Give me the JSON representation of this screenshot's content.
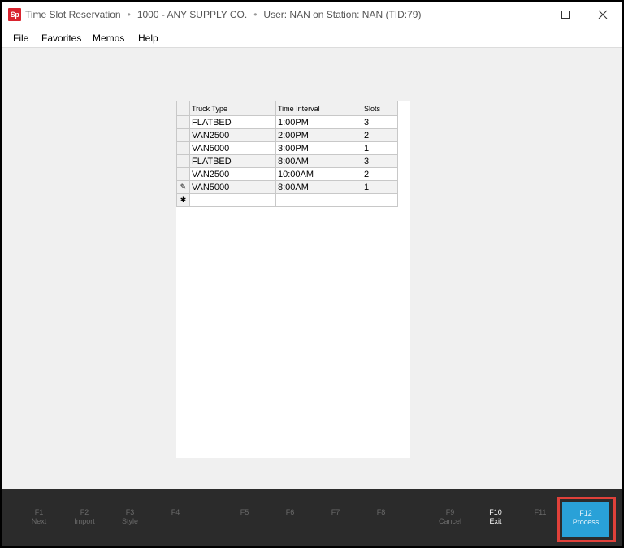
{
  "titlebar": {
    "app_icon": "Sp",
    "title": "Time Slot Reservation",
    "company": "1000 - ANY SUPPLY CO.",
    "user": "User: NAN on Station: NAN (TID:79)",
    "separator": "•"
  },
  "menu": {
    "items": [
      "File",
      "Favorites",
      "Memos",
      "Help"
    ]
  },
  "grid": {
    "columns": [
      "Truck Type",
      "Time Interval",
      "Slots"
    ],
    "rows": [
      {
        "indicator": "",
        "truck": "FLATBED",
        "time": "1:00PM",
        "slots": "3"
      },
      {
        "indicator": "",
        "truck": "VAN2500",
        "time": "2:00PM",
        "slots": "2"
      },
      {
        "indicator": "",
        "truck": "VAN5000",
        "time": "3:00PM",
        "slots": "1"
      },
      {
        "indicator": "",
        "truck": "FLATBED",
        "time": "8:00AM",
        "slots": "3"
      },
      {
        "indicator": "",
        "truck": "VAN2500",
        "time": "10:00AM",
        "slots": "2"
      },
      {
        "indicator": "✎",
        "truck": "VAN5000",
        "time": "8:00AM",
        "slots": "1"
      }
    ],
    "new_row_indicator": "✱"
  },
  "fkeys": [
    {
      "key": "F1",
      "label": "Next"
    },
    {
      "key": "F2",
      "label": "Import"
    },
    {
      "key": "F3",
      "label": "Style"
    },
    {
      "key": "F4",
      "label": ""
    },
    {
      "key": "F5",
      "label": ""
    },
    {
      "key": "F6",
      "label": ""
    },
    {
      "key": "F7",
      "label": ""
    },
    {
      "key": "F8",
      "label": ""
    },
    {
      "key": "F9",
      "label": "Cancel"
    },
    {
      "key": "F10",
      "label": "Exit"
    },
    {
      "key": "F11",
      "label": ""
    },
    {
      "key": "F12",
      "label": "Process"
    }
  ],
  "colors": {
    "accent": "#29a1d8",
    "highlight": "#e0413a",
    "app_icon": "#d9232e"
  }
}
